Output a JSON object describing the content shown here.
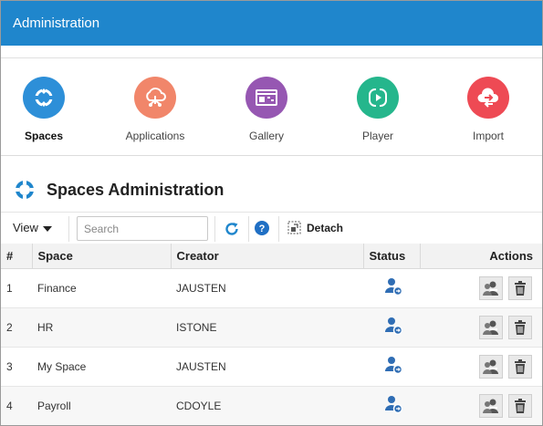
{
  "header": {
    "title": "Administration"
  },
  "nav": {
    "items": [
      {
        "label": "Spaces",
        "icon": "spaces-icon",
        "color": "#2d8fd8",
        "active": true
      },
      {
        "label": "Applications",
        "icon": "applications-cloud-icon",
        "color": "#f1866a",
        "active": false
      },
      {
        "label": "Gallery",
        "icon": "gallery-icon",
        "color": "#9657b2",
        "active": false
      },
      {
        "label": "Player",
        "icon": "player-icon",
        "color": "#25b68c",
        "active": false
      },
      {
        "label": "Import",
        "icon": "import-icon",
        "color": "#ee4a54",
        "active": false
      }
    ]
  },
  "section": {
    "title": "Spaces Administration"
  },
  "toolbar": {
    "view_label": "View",
    "search_placeholder": "Search",
    "detach_label": "Detach"
  },
  "table": {
    "columns": [
      "#",
      "Space",
      "Creator",
      "Status",
      "Actions"
    ],
    "rows": [
      {
        "num": "1",
        "space": "Finance",
        "creator": "JAUSTEN"
      },
      {
        "num": "2",
        "space": "HR",
        "creator": "ISTONE"
      },
      {
        "num": "3",
        "space": "My Space",
        "creator": "JAUSTEN"
      },
      {
        "num": "4",
        "space": "Payroll",
        "creator": "CDOYLE"
      }
    ]
  },
  "colors": {
    "accent": "#1f86cc",
    "status_icon": "#2f6db4"
  }
}
